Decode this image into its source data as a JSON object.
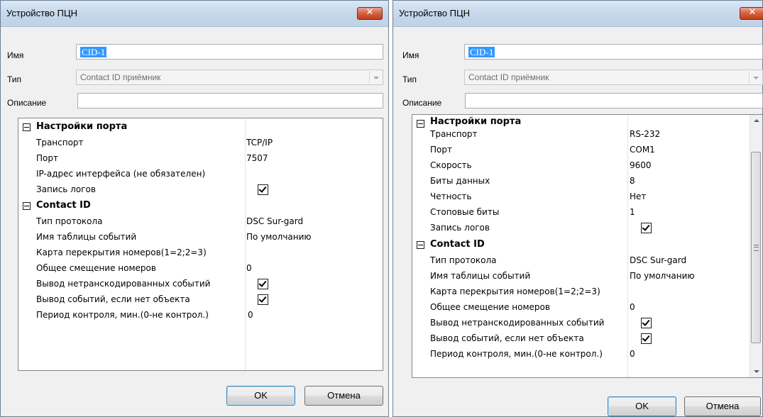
{
  "left": {
    "title": "Устройство ПЦН",
    "close_icon": "close-icon",
    "name_label": "Имя",
    "name_value": "CID-1",
    "type_label": "Тип",
    "type_value": "Contact ID приёмник",
    "desc_label": "Описание",
    "desc_value": "",
    "categories": [
      {
        "title": "Настройки порта",
        "rows": [
          {
            "name": "Транспорт",
            "value": "TCP/IP"
          },
          {
            "name": "Порт",
            "value": "7507"
          },
          {
            "name": "IP-адрес интерфейса (не обязателен)",
            "value": ""
          },
          {
            "name": "Запись логов",
            "checked": true
          }
        ]
      },
      {
        "title": "Contact ID",
        "rows": [
          {
            "name": "Тип протокола",
            "value": "DSC Sur-gard"
          },
          {
            "name": "Имя таблицы событий",
            "value": "По умолчанию"
          },
          {
            "name": "Карта перекрытия номеров(1=2;2=3)",
            "value": ""
          },
          {
            "name": "Общее смещение номеров",
            "value": "0"
          },
          {
            "name": "Вывод нетранскодированных событий",
            "checked": true
          },
          {
            "name": "Вывод событий, если нет объекта",
            "checked": true
          },
          {
            "name": "Период контроля, мин.(0-не контрол.)",
            "value": "0"
          }
        ]
      }
    ],
    "ok_label": "OK",
    "cancel_label": "Отмена"
  },
  "right": {
    "title": "Устройство ПЦН",
    "close_icon": "close-icon",
    "name_label": "Имя",
    "name_value": "CID-1",
    "type_label": "Тип",
    "type_value": "Contact ID приёмник",
    "desc_label": "Описание",
    "desc_value": "",
    "categories": [
      {
        "title": "Настройки порта",
        "rows": [
          {
            "name": "Транспорт",
            "value": "RS-232"
          },
          {
            "name": "Порт",
            "value": "COM1"
          },
          {
            "name": "Скорость",
            "value": "9600"
          },
          {
            "name": "Биты данных",
            "value": "8"
          },
          {
            "name": "Четность",
            "value": "Нет"
          },
          {
            "name": "Стоповые биты",
            "value": "1"
          },
          {
            "name": "Запись логов",
            "checked": true
          }
        ]
      },
      {
        "title": "Contact ID",
        "rows": [
          {
            "name": "Тип протокола",
            "value": "DSC Sur-gard"
          },
          {
            "name": "Имя таблицы событий",
            "value": "По умолчанию"
          },
          {
            "name": "Карта перекрытия номеров(1=2;2=3)",
            "value": ""
          },
          {
            "name": "Общее смещение номеров",
            "value": "0"
          },
          {
            "name": "Вывод нетранскодированных событий",
            "checked": true
          },
          {
            "name": "Вывод событий, если нет объекта",
            "checked": true
          },
          {
            "name": "Период контроля, мин.(0-не контрол.)",
            "value": "0"
          }
        ]
      }
    ],
    "ok_label": "OK",
    "cancel_label": "Отмена"
  }
}
